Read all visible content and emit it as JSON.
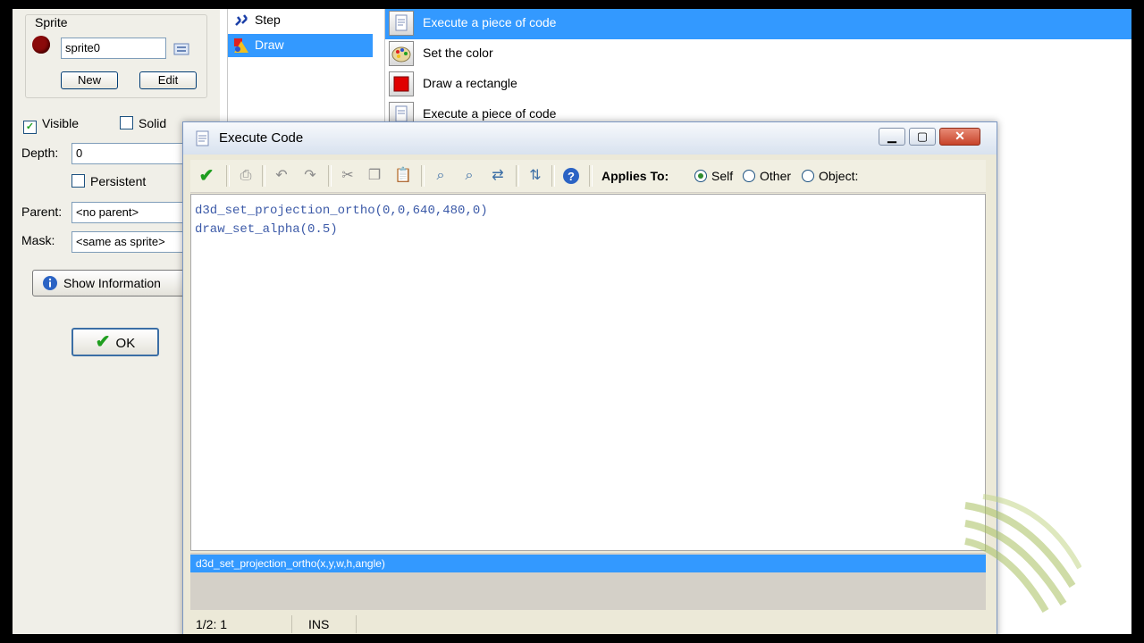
{
  "object_panel": {
    "sprite_group_title": "Sprite",
    "sprite_name": "sprite0",
    "new_label": "New",
    "edit_label": "Edit",
    "visible_label": "Visible",
    "solid_label": "Solid",
    "depth_label": "Depth:",
    "depth_value": "0",
    "persistent_label": "Persistent",
    "parent_label": "Parent:",
    "parent_value": "<no parent>",
    "mask_label": "Mask:",
    "mask_value": "<same as sprite>",
    "info_button": "Show Information",
    "ok_button": "OK",
    "visible_checked": true,
    "solid_checked": false,
    "persistent_checked": false
  },
  "events": [
    {
      "label": "Step",
      "selected": false
    },
    {
      "label": "Draw",
      "selected": true
    }
  ],
  "actions": [
    {
      "label": "Execute a piece of code",
      "selected": true
    },
    {
      "label": "Set the color",
      "selected": false
    },
    {
      "label": "Draw a rectangle",
      "selected": false
    },
    {
      "label": "Execute a piece of code",
      "selected": false
    }
  ],
  "dialog": {
    "title": "Execute Code",
    "applies_to_label": "Applies To:",
    "applies_options": [
      {
        "label": "Self",
        "selected": true
      },
      {
        "label": "Other",
        "selected": false
      },
      {
        "label": "Object:",
        "selected": false
      }
    ],
    "code_lines": [
      "d3d_set_projection_ortho(0,0,640,480,0)",
      "draw_set_alpha(0.5)"
    ],
    "hint": "d3d_set_projection_ortho(x,y,w,h,angle)",
    "status_position": "1/2:  1",
    "status_mode": "INS"
  },
  "colors": {
    "selection": "#3399ff",
    "code_text": "#3c5aa8",
    "panel_bg": "#f0efe8"
  }
}
